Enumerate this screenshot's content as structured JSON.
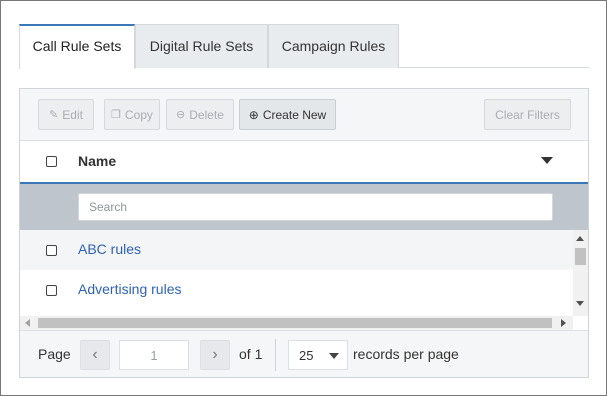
{
  "tabs": [
    {
      "label": "Call Rule Sets",
      "active": true
    },
    {
      "label": "Digital Rule Sets",
      "active": false
    },
    {
      "label": "Campaign Rules",
      "active": false
    }
  ],
  "toolbar": {
    "edit_label": "Edit",
    "copy_label": "Copy",
    "delete_label": "Delete",
    "create_label": "Create New",
    "clear_filters_label": "Clear Filters",
    "icons": {
      "edit": "pencil-icon",
      "copy": "copy-icon",
      "delete": "minus-circle-icon",
      "create": "plus-circle-icon"
    }
  },
  "grid": {
    "column_header": "Name",
    "search_placeholder": "Search",
    "rows": [
      {
        "name": "ABC rules"
      },
      {
        "name": "Advertising rules"
      }
    ]
  },
  "pager": {
    "page_label": "Page",
    "current_page": "1",
    "of_label": "of 1",
    "page_size": "25",
    "records_label": "records per page"
  },
  "colors": {
    "accent": "#3b78b8",
    "link": "#2e62b3",
    "filter_row_bg": "#bfc5cd"
  }
}
